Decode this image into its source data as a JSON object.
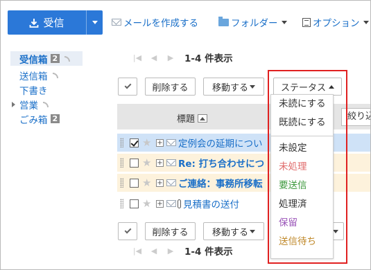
{
  "toolbar": {
    "receive_label": "受信",
    "compose_label": "メールを作成する",
    "folder_label": "フォルダー",
    "options_label": "オプション"
  },
  "sidebar": {
    "items": [
      {
        "label": "受信箱",
        "badge": "2"
      },
      {
        "label": "送信箱"
      },
      {
        "label": "下書き"
      },
      {
        "label": "営業"
      },
      {
        "label": "ごみ箱",
        "badge": "2"
      }
    ]
  },
  "pager": {
    "text_top": "1-4 件表示",
    "text_bottom": "1-4 件表示"
  },
  "actions": {
    "delete_label": "削除する",
    "move_label": "移動する",
    "status_label": "ステータス"
  },
  "list": {
    "column_title": "標題",
    "filter_label": "絞り込",
    "rows": [
      {
        "subject": "定例会の延期につい"
      },
      {
        "subject": "Re: 打ち合わせにつ"
      },
      {
        "subject": "ご連絡：事務所移転"
      },
      {
        "subject": "見積書の送付"
      }
    ]
  },
  "status_menu": {
    "items": [
      {
        "label": "未読にする",
        "color": "#333333"
      },
      {
        "label": "既読にする",
        "color": "#333333"
      },
      {
        "label": "未設定",
        "color": "#333333"
      },
      {
        "label": "未処理",
        "color": "#e06b6b"
      },
      {
        "label": "要送信",
        "color": "#3f9a3f"
      },
      {
        "label": "処理済",
        "color": "#333333"
      },
      {
        "label": "保留",
        "color": "#9a55b8"
      },
      {
        "label": "送信待ち",
        "color": "#c08a2c"
      }
    ]
  },
  "colors": {
    "accent": "#2b78d8",
    "highlight": "#e02020"
  }
}
